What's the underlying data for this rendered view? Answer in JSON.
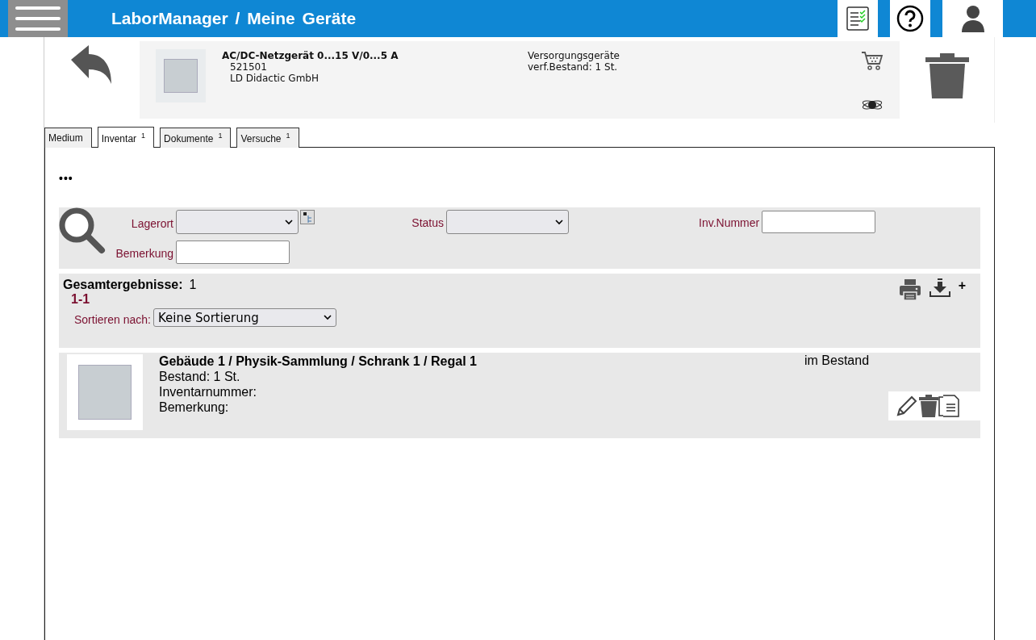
{
  "header": {
    "title": "LaborManager / Meine Geräte"
  },
  "product": {
    "name": "AC/DC-Netzgerät 0...15 V/0...5 A",
    "number": "521501",
    "manufacturer": "LD Didactic GmbH",
    "category": "Versorgungsgeräte",
    "stock": "verf.Bestand: 1 St."
  },
  "tabs": [
    {
      "label": "Medium",
      "selected": false
    },
    {
      "label": "Inventar",
      "count": "1",
      "selected": true
    },
    {
      "label": "Dokumente",
      "count": "1",
      "selected": false
    },
    {
      "label": "Versuche",
      "count": "1",
      "selected": false
    }
  ],
  "more": "•••",
  "search": {
    "fields": [
      {
        "kind": "select_tree",
        "label": "Lagerort"
      },
      {
        "kind": "select",
        "label": "Status"
      },
      {
        "kind": "input",
        "label": "Inv.Nummer"
      },
      {
        "kind": "input",
        "label": "Bemerkung"
      }
    ]
  },
  "results": {
    "total_label": "Gesamtergebnisse:",
    "total": "1",
    "range": "1-1",
    "sort_label": "Sortieren nach:",
    "sort_value": "Keine Sortierung",
    "add": "+"
  },
  "items": [
    {
      "location": "Gebäude 1 / Physik-Sammlung / Schrank 1 / Regal 1",
      "stock": "Bestand: 1 St.",
      "inventory_number": "Inventarnummer:",
      "remark": "Bemerkung:",
      "status": "im Bestand"
    }
  ]
}
